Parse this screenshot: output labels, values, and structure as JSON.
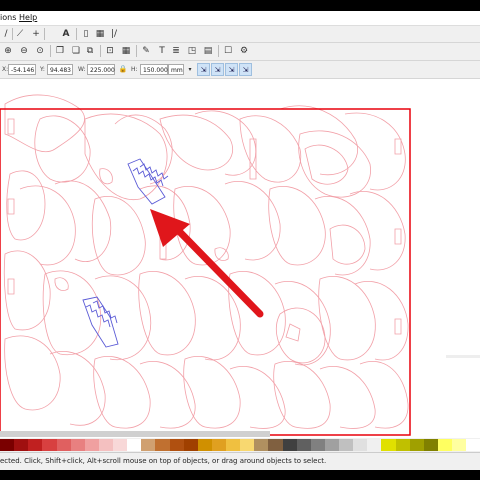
{
  "menubar": {
    "item1": "ions",
    "item2": "Help"
  },
  "toolbar_transform": {
    "x_label": "X:",
    "x_value": "-54.146",
    "y_label": "Y:",
    "y_value": "94.483",
    "w_label": "W:",
    "w_value": "225.000",
    "h_label": "H:",
    "h_value": "150.000",
    "unit": "mm"
  },
  "status": {
    "message": "ected. Click, Shift+click, Alt+scroll mouse on top of objects, or drag around objects to select."
  },
  "colors": {
    "selection_border": "#e8000b",
    "shapes_stroke": "#f2a0a8",
    "arrow": "#e0161b",
    "springs": "#5b5bd6"
  },
  "palette": [
    "#7a0000",
    "#a01010",
    "#c02020",
    "#d84040",
    "#e06060",
    "#e88080",
    "#f0a0a0",
    "#f4c0c0",
    "#f8d8d8",
    "#ffffff",
    "#d0a070",
    "#c07030",
    "#b05010",
    "#a04000",
    "#d09000",
    "#e0a020",
    "#f0c040",
    "#f8d870",
    "#b09060",
    "#806040",
    "#404040",
    "#606060",
    "#808080",
    "#a0a0a0",
    "#c0c0c0",
    "#e0e0e0",
    "#f0f0f0",
    "#e0e000",
    "#c0c000",
    "#a0a000",
    "#808000",
    "#ffff60",
    "#ffffa0",
    "#ffffff"
  ]
}
